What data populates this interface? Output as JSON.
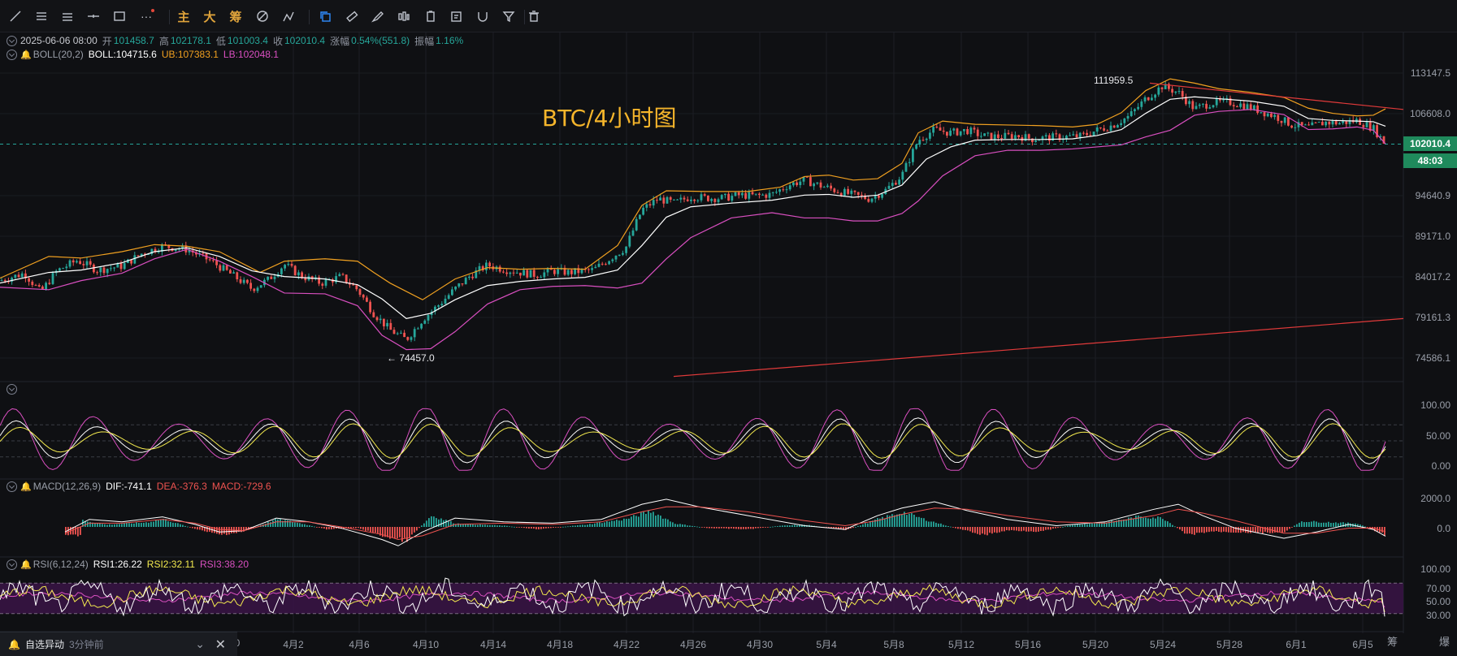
{
  "toolbar": {
    "icons": [
      "trendline-icon",
      "parallel-lines-icon",
      "horizontal-lines-icon",
      "crosshair-line-icon",
      "rectangle-icon",
      "more-icon",
      "fib-icon",
      "ruler-icon",
      "brush-icon",
      "pattern-icon",
      "clipboard-icon",
      "note-icon",
      "magnet-icon",
      "filter-icon",
      "trash-icon"
    ],
    "text_buttons": [
      "主",
      "大",
      "筹"
    ]
  },
  "ohlc": {
    "date": "2025-06-06 08:00",
    "open_label": "开",
    "open": "101458.7",
    "high_label": "高",
    "high": "102178.1",
    "low_label": "低",
    "low": "101003.4",
    "close_label": "收",
    "close": "102010.4",
    "change_label": "涨幅",
    "change": "0.54%(551.8)",
    "amp_label": "振幅",
    "amp": "1.16%"
  },
  "boll": {
    "name": "BOLL(20,2)",
    "mid": "BOLL:104715.6",
    "ub": "UB:107383.1",
    "lb": "LB:102048.1"
  },
  "macd": {
    "name": "MACD(12,26,9)",
    "dif": "DIF:-741.1",
    "dea": "DEA:-376.3",
    "macd": "MACD:-729.6"
  },
  "rsi": {
    "name": "RSI(6,12,24)",
    "rsi1": "RSI1:26.22",
    "rsi2": "RSI2:32.11",
    "rsi3": "RSI3:38.20"
  },
  "title": "BTC/4小时图",
  "annotations": {
    "high_mark": "111959.5",
    "low_mark": "← 74457.0"
  },
  "current_price": "102010.4",
  "countdown": "48:03",
  "notice": {
    "title": "自选异动",
    "time": "3分钟前"
  },
  "right_strip": [
    "筹",
    "爆"
  ],
  "colors": {
    "up": "#26a69a",
    "down": "#ef5350",
    "boll_mid": "#ffffff",
    "boll_ub": "#f0a020",
    "boll_lb": "#d94fc0",
    "title": "#f5b52b",
    "trend": "#e03a3a"
  },
  "chart_data": {
    "type": "candlestick",
    "price_axis": [
      "113147.5",
      "106608.0",
      "94640.9",
      "89171.0",
      "84017.2",
      "79161.3",
      "74586.1"
    ],
    "kdj_axis": [
      "100.00",
      "50.00",
      "0.00"
    ],
    "macd_axis": [
      "2000.0",
      "0.0"
    ],
    "rsi_axis": [
      "100.00",
      "70.00",
      "50.00",
      "30.00"
    ],
    "x_labels": [
      "4月2",
      "4月6",
      "4月10",
      "4月14",
      "4月18",
      "4月22",
      "4月26",
      "4月30",
      "5月4",
      "5月8",
      "5月12",
      "5月16",
      "5月20",
      "5月24",
      "5月28",
      "6月1",
      "6月5"
    ],
    "x_label_partial": "0",
    "price_path": [
      [
        0,
        83600
      ],
      [
        30,
        84500
      ],
      [
        50,
        82200
      ],
      [
        70,
        84800
      ],
      [
        95,
        86100
      ],
      [
        120,
        84900
      ],
      [
        150,
        85400
      ],
      [
        175,
        87000
      ],
      [
        200,
        87900
      ],
      [
        230,
        87500
      ],
      [
        260,
        86000
      ],
      [
        290,
        84000
      ],
      [
        310,
        82600
      ],
      [
        330,
        83700
      ],
      [
        350,
        85600
      ],
      [
        370,
        84200
      ],
      [
        395,
        83300
      ],
      [
        420,
        84100
      ],
      [
        440,
        82500
      ],
      [
        460,
        79700
      ],
      [
        480,
        77800
      ],
      [
        500,
        76700
      ],
      [
        520,
        79000
      ],
      [
        540,
        80700
      ],
      [
        560,
        82600
      ],
      [
        580,
        84300
      ],
      [
        600,
        85500
      ],
      [
        620,
        85000
      ],
      [
        640,
        84600
      ],
      [
        660,
        84300
      ],
      [
        680,
        84800
      ],
      [
        700,
        84600
      ],
      [
        730,
        84900
      ],
      [
        750,
        86300
      ],
      [
        770,
        87700
      ],
      [
        790,
        92700
      ],
      [
        810,
        94200
      ],
      [
        830,
        93600
      ],
      [
        850,
        94500
      ],
      [
        870,
        94300
      ],
      [
        890,
        94300
      ],
      [
        910,
        94700
      ],
      [
        930,
        94600
      ],
      [
        950,
        94800
      ],
      [
        970,
        96100
      ],
      [
        990,
        96800
      ],
      [
        1010,
        96000
      ],
      [
        1030,
        95300
      ],
      [
        1050,
        94700
      ],
      [
        1070,
        94200
      ],
      [
        1090,
        95400
      ],
      [
        1110,
        97500
      ],
      [
        1130,
        102600
      ],
      [
        1150,
        104200
      ],
      [
        1170,
        103700
      ],
      [
        1190,
        104100
      ],
      [
        1210,
        103200
      ],
      [
        1230,
        103100
      ],
      [
        1250,
        103300
      ],
      [
        1270,
        102800
      ],
      [
        1290,
        103000
      ],
      [
        1310,
        103100
      ],
      [
        1330,
        103200
      ],
      [
        1350,
        104100
      ],
      [
        1370,
        104900
      ],
      [
        1390,
        106300
      ],
      [
        1410,
        109000
      ],
      [
        1430,
        111000
      ],
      [
        1450,
        110000
      ],
      [
        1470,
        107400
      ],
      [
        1490,
        108300
      ],
      [
        1510,
        108500
      ],
      [
        1530,
        108000
      ],
      [
        1550,
        107100
      ],
      [
        1570,
        106200
      ],
      [
        1590,
        104900
      ],
      [
        1610,
        104500
      ],
      [
        1630,
        105300
      ],
      [
        1650,
        105200
      ],
      [
        1670,
        105600
      ],
      [
        1690,
        104400
      ],
      [
        1705,
        102010
      ]
    ],
    "ub_path": [
      [
        0,
        83900
      ],
      [
        60,
        86600
      ],
      [
        100,
        86400
      ],
      [
        150,
        87200
      ],
      [
        190,
        88100
      ],
      [
        230,
        87900
      ],
      [
        270,
        87200
      ],
      [
        320,
        84600
      ],
      [
        350,
        86000
      ],
      [
        400,
        86300
      ],
      [
        440,
        86000
      ],
      [
        460,
        84600
      ],
      [
        480,
        83300
      ],
      [
        520,
        81300
      ],
      [
        560,
        83800
      ],
      [
        600,
        85200
      ],
      [
        640,
        85000
      ],
      [
        680,
        85100
      ],
      [
        720,
        85000
      ],
      [
        760,
        88000
      ],
      [
        790,
        93300
      ],
      [
        820,
        95300
      ],
      [
        870,
        95200
      ],
      [
        920,
        95200
      ],
      [
        960,
        95800
      ],
      [
        990,
        97300
      ],
      [
        1020,
        97500
      ],
      [
        1050,
        96800
      ],
      [
        1080,
        97000
      ],
      [
        1110,
        99200
      ],
      [
        1130,
        103700
      ],
      [
        1160,
        105500
      ],
      [
        1200,
        105000
      ],
      [
        1240,
        104900
      ],
      [
        1280,
        104800
      ],
      [
        1320,
        104600
      ],
      [
        1350,
        105000
      ],
      [
        1380,
        106800
      ],
      [
        1410,
        110300
      ],
      [
        1440,
        112200
      ],
      [
        1470,
        111500
      ],
      [
        1500,
        110600
      ],
      [
        1540,
        110000
      ],
      [
        1580,
        109200
      ],
      [
        1610,
        107500
      ],
      [
        1640,
        106700
      ],
      [
        1670,
        106300
      ],
      [
        1690,
        106400
      ],
      [
        1705,
        107400
      ]
    ],
    "mid_path": [
      [
        0,
        83300
      ],
      [
        60,
        84600
      ],
      [
        100,
        84900
      ],
      [
        150,
        85800
      ],
      [
        190,
        87200
      ],
      [
        230,
        87700
      ],
      [
        270,
        86600
      ],
      [
        310,
        84800
      ],
      [
        350,
        84100
      ],
      [
        400,
        83800
      ],
      [
        440,
        83100
      ],
      [
        470,
        81400
      ],
      [
        500,
        79100
      ],
      [
        530,
        79700
      ],
      [
        560,
        81300
      ],
      [
        600,
        83000
      ],
      [
        640,
        83500
      ],
      [
        680,
        83800
      ],
      [
        720,
        84000
      ],
      [
        760,
        84900
      ],
      [
        790,
        88000
      ],
      [
        820,
        91700
      ],
      [
        850,
        93100
      ],
      [
        900,
        93600
      ],
      [
        950,
        94000
      ],
      [
        990,
        94700
      ],
      [
        1020,
        94800
      ],
      [
        1050,
        94400
      ],
      [
        1080,
        94700
      ],
      [
        1110,
        96100
      ],
      [
        1140,
        99800
      ],
      [
        1170,
        101600
      ],
      [
        1200,
        102600
      ],
      [
        1240,
        102700
      ],
      [
        1280,
        102700
      ],
      [
        1320,
        102800
      ],
      [
        1350,
        103300
      ],
      [
        1380,
        104200
      ],
      [
        1410,
        106700
      ],
      [
        1440,
        108900
      ],
      [
        1470,
        109300
      ],
      [
        1500,
        109000
      ],
      [
        1540,
        108600
      ],
      [
        1580,
        107800
      ],
      [
        1610,
        105900
      ],
      [
        1640,
        105600
      ],
      [
        1670,
        105500
      ],
      [
        1690,
        105400
      ],
      [
        1705,
        104716
      ]
    ],
    "lb_path": [
      [
        0,
        82800
      ],
      [
        60,
        82500
      ],
      [
        100,
        83600
      ],
      [
        150,
        84500
      ],
      [
        190,
        86300
      ],
      [
        230,
        87500
      ],
      [
        270,
        86000
      ],
      [
        310,
        84100
      ],
      [
        350,
        82100
      ],
      [
        400,
        82000
      ],
      [
        440,
        80600
      ],
      [
        470,
        77200
      ],
      [
        500,
        75600
      ],
      [
        530,
        75700
      ],
      [
        560,
        77600
      ],
      [
        600,
        80800
      ],
      [
        640,
        82500
      ],
      [
        680,
        82900
      ],
      [
        720,
        83000
      ],
      [
        760,
        82700
      ],
      [
        790,
        83300
      ],
      [
        820,
        86300
      ],
      [
        850,
        89000
      ],
      [
        900,
        91600
      ],
      [
        950,
        92300
      ],
      [
        990,
        91600
      ],
      [
        1020,
        91600
      ],
      [
        1050,
        91200
      ],
      [
        1080,
        91200
      ],
      [
        1110,
        92200
      ],
      [
        1130,
        93900
      ],
      [
        1160,
        97400
      ],
      [
        1200,
        100300
      ],
      [
        1240,
        101100
      ],
      [
        1280,
        101100
      ],
      [
        1320,
        101300
      ],
      [
        1350,
        101600
      ],
      [
        1380,
        101900
      ],
      [
        1410,
        103100
      ],
      [
        1440,
        104100
      ],
      [
        1470,
        106400
      ],
      [
        1500,
        107000
      ],
      [
        1540,
        107300
      ],
      [
        1580,
        106500
      ],
      [
        1610,
        104200
      ],
      [
        1640,
        104300
      ],
      [
        1670,
        104600
      ],
      [
        1690,
        104100
      ],
      [
        1705,
        102048
      ]
    ],
    "trend_lines": [
      {
        "from": [
          1415,
          111500
        ],
        "to": [
          1727,
          107300
        ]
      },
      {
        "from": [
          829,
          72700
        ],
        "to": [
          1727,
          79100
        ]
      }
    ],
    "macd_hist": [
      [
        100,
        600
      ],
      [
        130,
        200
      ],
      [
        180,
        400
      ],
      [
        200,
        700
      ],
      [
        240,
        -200
      ],
      [
        270,
        -700
      ],
      [
        300,
        -400
      ],
      [
        340,
        700
      ],
      [
        370,
        300
      ],
      [
        400,
        -200
      ],
      [
        440,
        -100
      ],
      [
        475,
        -900
      ],
      [
        500,
        -1200
      ],
      [
        530,
        1000
      ],
      [
        560,
        300
      ],
      [
        620,
        100
      ],
      [
        660,
        -200
      ],
      [
        720,
        200
      ],
      [
        770,
        700
      ],
      [
        800,
        1400
      ],
      [
        830,
        300
      ],
      [
        870,
        -100
      ],
      [
        920,
        -200
      ],
      [
        960,
        100
      ],
      [
        990,
        200
      ],
      [
        1040,
        -300
      ],
      [
        1080,
        700
      ],
      [
        1110,
        1300
      ],
      [
        1140,
        600
      ],
      [
        1180,
        -200
      ],
      [
        1210,
        -700
      ],
      [
        1240,
        -300
      ],
      [
        1280,
        -400
      ],
      [
        1320,
        200
      ],
      [
        1360,
        400
      ],
      [
        1400,
        900
      ],
      [
        1430,
        800
      ],
      [
        1460,
        -700
      ],
      [
        1490,
        -400
      ],
      [
        1540,
        -500
      ],
      [
        1580,
        -500
      ],
      [
        1600,
        500
      ],
      [
        1640,
        400
      ],
      [
        1670,
        300
      ],
      [
        1690,
        -300
      ],
      [
        1705,
        -730
      ]
    ],
    "macd_dif": [
      [
        80,
        -400
      ],
      [
        110,
        600
      ],
      [
        150,
        400
      ],
      [
        200,
        800
      ],
      [
        240,
        200
      ],
      [
        270,
        -400
      ],
      [
        300,
        -300
      ],
      [
        340,
        700
      ],
      [
        380,
        400
      ],
      [
        420,
        -100
      ],
      [
        470,
        -1000
      ],
      [
        490,
        -1500
      ],
      [
        520,
        -400
      ],
      [
        560,
        700
      ],
      [
        620,
        400
      ],
      [
        680,
        300
      ],
      [
        740,
        600
      ],
      [
        790,
        1800
      ],
      [
        820,
        2200
      ],
      [
        860,
        1600
      ],
      [
        920,
        900
      ],
      [
        990,
        100
      ],
      [
        1040,
        -200
      ],
      [
        1080,
        900
      ],
      [
        1110,
        1500
      ],
      [
        1150,
        2000
      ],
      [
        1190,
        1300
      ],
      [
        1240,
        600
      ],
      [
        1300,
        100
      ],
      [
        1360,
        400
      ],
      [
        1420,
        1400
      ],
      [
        1450,
        1800
      ],
      [
        1480,
        900
      ],
      [
        1520,
        -100
      ],
      [
        1580,
        -900
      ],
      [
        1620,
        -400
      ],
      [
        1660,
        200
      ],
      [
        1690,
        -200
      ],
      [
        1705,
        -741
      ]
    ],
    "macd_dea": [
      [
        80,
        -500
      ],
      [
        110,
        300
      ],
      [
        150,
        300
      ],
      [
        200,
        600
      ],
      [
        240,
        300
      ],
      [
        270,
        -200
      ],
      [
        300,
        -300
      ],
      [
        340,
        400
      ],
      [
        380,
        400
      ],
      [
        420,
        0
      ],
      [
        470,
        -600
      ],
      [
        490,
        -1000
      ],
      [
        520,
        -700
      ],
      [
        560,
        200
      ],
      [
        620,
        300
      ],
      [
        680,
        200
      ],
      [
        740,
        400
      ],
      [
        790,
        1200
      ],
      [
        820,
        1600
      ],
      [
        860,
        1600
      ],
      [
        920,
        1200
      ],
      [
        990,
        500
      ],
      [
        1040,
        100
      ],
      [
        1080,
        500
      ],
      [
        1110,
        1000
      ],
      [
        1150,
        1500
      ],
      [
        1190,
        1400
      ],
      [
        1240,
        900
      ],
      [
        1300,
        400
      ],
      [
        1360,
        300
      ],
      [
        1420,
        900
      ],
      [
        1450,
        1400
      ],
      [
        1480,
        1100
      ],
      [
        1520,
        500
      ],
      [
        1580,
        -500
      ],
      [
        1620,
        -500
      ],
      [
        1660,
        -100
      ],
      [
        1690,
        -100
      ],
      [
        1705,
        -376
      ]
    ],
    "rsi_current": {
      "rsi1": 26.22,
      "rsi2": 32.11,
      "rsi3": 38.2
    }
  }
}
